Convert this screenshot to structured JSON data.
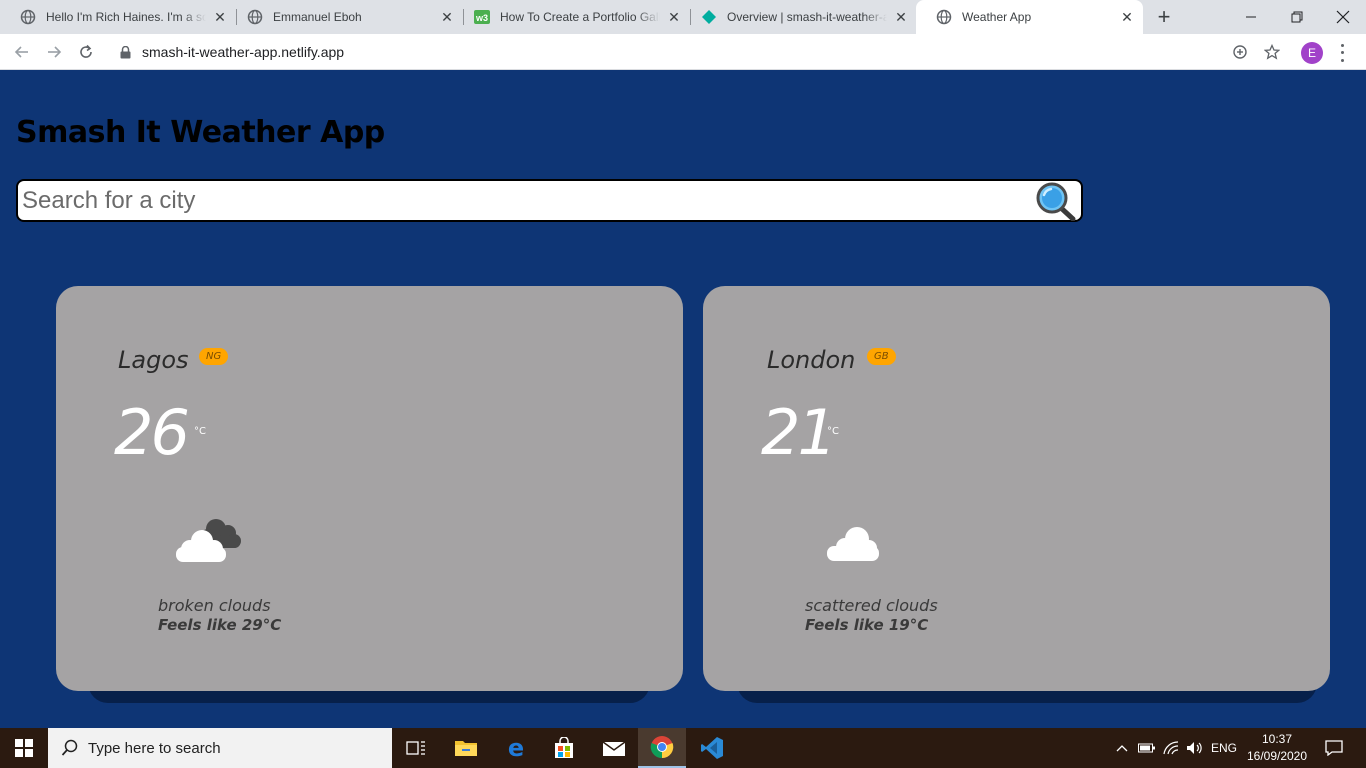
{
  "browser": {
    "tabs": [
      {
        "title": "Hello I'm Rich Haines. I'm a software developer",
        "icon": "globe-icon"
      },
      {
        "title": "Emmanuel Eboh",
        "icon": "globe-icon"
      },
      {
        "title": "How To Create a Portfolio Gallery",
        "icon": "w3schools-icon"
      },
      {
        "title": "Overview | smash-it-weather-app",
        "icon": "netlify-icon"
      },
      {
        "title": "Weather App",
        "icon": "globe-icon",
        "active": true
      }
    ],
    "url": "smash-it-weather-app.netlify.app",
    "profile_initial": "E"
  },
  "app": {
    "title": "Smash It Weather App",
    "search_placeholder": "Search for a city"
  },
  "cities": [
    {
      "name": "Lagos",
      "country": "NG",
      "temp": "26",
      "unit": "°C",
      "description": "broken clouds",
      "feels_like": "Feels like 29°C",
      "icon": "broken-clouds-icon"
    },
    {
      "name": "London",
      "country": "GB",
      "temp": "21",
      "unit": "°C",
      "description": "scattered clouds",
      "feels_like": "Feels like 19°C",
      "icon": "scattered-clouds-icon"
    }
  ],
  "taskbar": {
    "search_placeholder": "Type here to search",
    "language": "ENG",
    "time": "10:37",
    "date": "16/09/2020"
  },
  "colors": {
    "page_background": "#0e3575",
    "card_background": "#a5a3a4",
    "country_badge": "#ffa500"
  }
}
